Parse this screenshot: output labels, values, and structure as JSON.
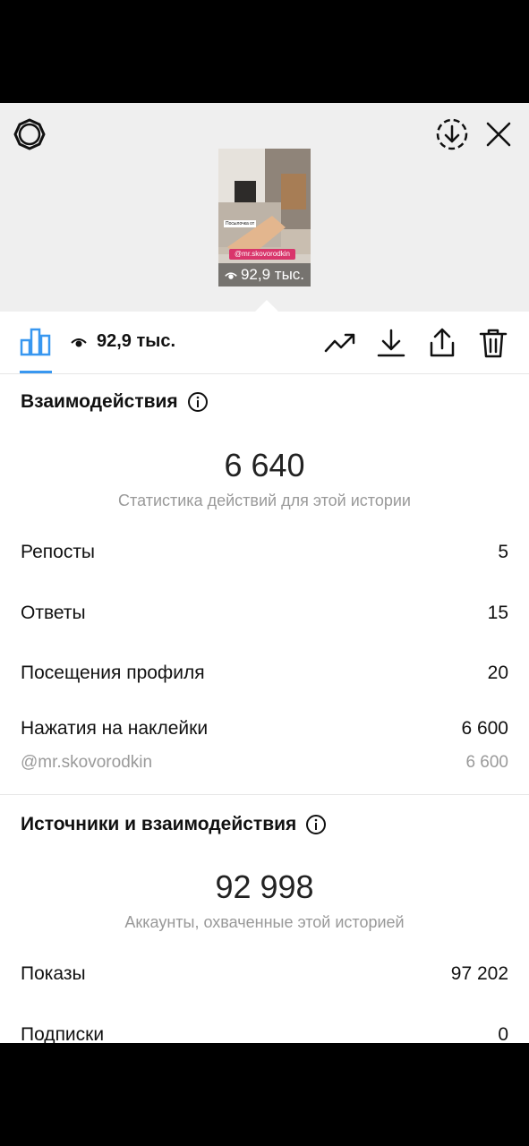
{
  "header": {
    "settings_icon": "settings-gear-icon",
    "download_icon": "download-circle-icon",
    "close_icon": "close-icon"
  },
  "story_preview": {
    "views_label": "92,9 тыс.",
    "sticker_mention": "@mr.skovorodkin",
    "sticker_caption": "Посылочка от"
  },
  "toolbar": {
    "views_label": "92,9 тыс.",
    "icons": [
      "bar-chart-icon",
      "eye-icon",
      "trending-up-icon",
      "download-icon",
      "share-icon",
      "trash-icon"
    ],
    "accent_color": "#3897f0"
  },
  "interactions": {
    "title": "Взаимодействия",
    "total": "6 640",
    "caption": "Статистика действий для этой истории",
    "rows": [
      {
        "label": "Репосты",
        "value": "5"
      },
      {
        "label": "Ответы",
        "value": "15"
      },
      {
        "label": "Посещения профиля",
        "value": "20"
      },
      {
        "label": "Нажатия на наклейки",
        "value": "6 600"
      }
    ],
    "sub_row": {
      "label": "@mr.skovorodkin",
      "value": "6 600"
    }
  },
  "discovery": {
    "title": "Источники и взаимодействия",
    "total": "92 998",
    "caption": "Аккаунты, охваченные этой историей",
    "rows": [
      {
        "label": "Показы",
        "value": "97 202"
      },
      {
        "label": "Подписки",
        "value": "0"
      }
    ]
  }
}
